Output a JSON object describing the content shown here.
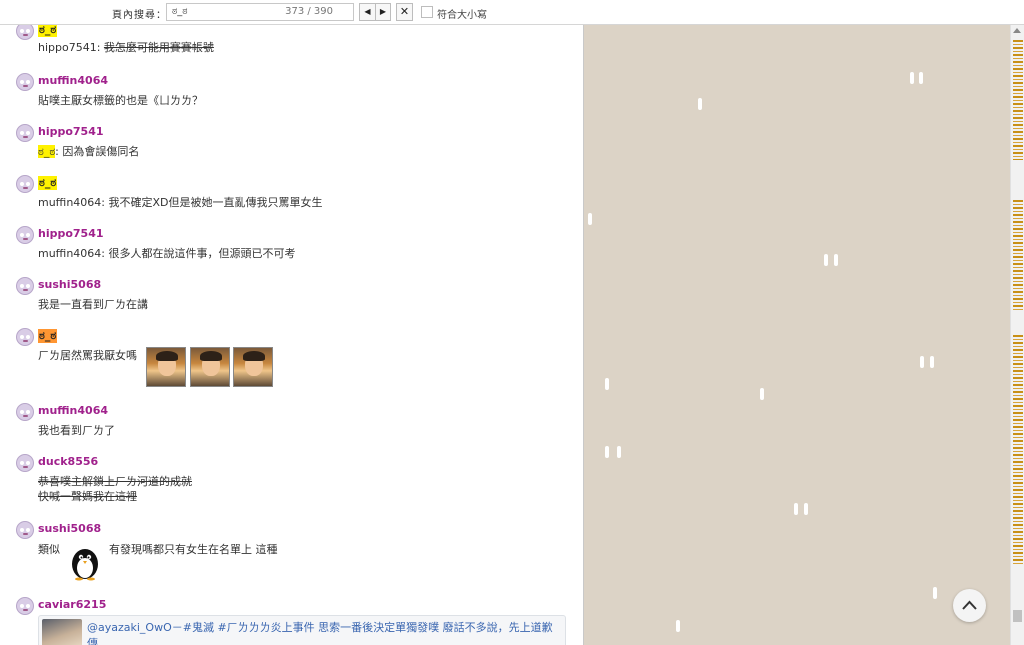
{
  "findbar": {
    "label": "頁內搜尋：",
    "query": "ಠ_ಠ",
    "count": "373 / 390",
    "prev_icon": "triangle-left-icon",
    "next_icon": "triangle-right-icon",
    "close_label": "✕",
    "match_case_label": "符合大小寫"
  },
  "messages": [
    {
      "user": "ಠ_ಠ",
      "lines": [
        {
          "prefix": "hippo7541: ",
          "text": "我怎麼可能用賽賽帳號"
        }
      ]
    },
    {
      "user": "muffin4064",
      "lines": [
        {
          "text": "貼噗主厭女標籤的也是《ㄩㄌㄌ？"
        }
      ]
    },
    {
      "user": "hippo7541",
      "lines": [
        {
          "hl": "ಠ_ಠ",
          "text": ": 因為會誤傷同名"
        }
      ]
    },
    {
      "user": "ಠ_ಠ",
      "lines": [
        {
          "prefix": "muffin4064: ",
          "text": "我不確定XD但是被她一直亂傳我只罵單女生"
        }
      ]
    },
    {
      "user": "hippo7541",
      "lines": [
        {
          "prefix": "muffin4064: ",
          "text": "很多人都在說這件事，但源頭已不可考"
        }
      ]
    },
    {
      "user": "sushi5068",
      "lines": [
        {
          "text": "我是一直看到ㄏㄌ在講"
        }
      ]
    },
    {
      "user": "ಠ_ಠ",
      "lines": [
        {
          "text": "ㄏㄌ居然罵我厭女嗎"
        }
      ]
    },
    {
      "user": "muffin4064",
      "lines": [
        {
          "text": "我也看到ㄏㄌ了"
        }
      ]
    },
    {
      "user": "duck8556",
      "lines": [
        {
          "text": "恭喜噗主解鎖上ㄏㄌ河道的成就"
        },
        {
          "text": "快喊一聲媽我在這裡"
        }
      ]
    },
    {
      "user": "sushi5068",
      "lines": [
        {
          "text": "類似"
        },
        {
          "text": "有發現嗎都只有女生在名單上 這種"
        }
      ]
    },
    {
      "user": "caviar6215",
      "card": "@ayazaki_OwO－#鬼滅 #ㄏㄌㄌㄌ炎上事件 思索一番後決定單獨發噗 廢話不多說，先上道歉傳"
    }
  ],
  "icons": {
    "avatar": "avatar-icon",
    "penguin": "penguin-sticker-icon",
    "back_to_top": "chevron-up-icon",
    "scroll_up": "scroll-up-arrow-icon"
  },
  "colors": {
    "username": "#a0218c",
    "highlight": "#fff200",
    "current_highlight": "#ff9632",
    "background": "#dcd3c6",
    "match_marker": "#c89017"
  }
}
